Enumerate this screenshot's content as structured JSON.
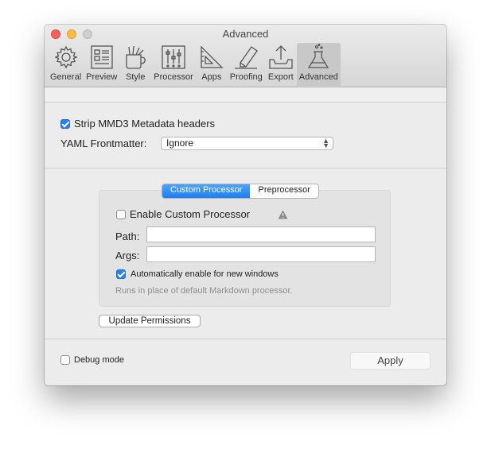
{
  "window": {
    "title": "Advanced"
  },
  "toolbar": {
    "items": [
      {
        "label": "General",
        "icon": "gear-icon"
      },
      {
        "label": "Preview",
        "icon": "preview-icon"
      },
      {
        "label": "Style",
        "icon": "style-icon"
      },
      {
        "label": "Processor",
        "icon": "processor-icon"
      },
      {
        "label": "Apps",
        "icon": "apps-icon"
      },
      {
        "label": "Proofing",
        "icon": "proofing-icon"
      },
      {
        "label": "Export",
        "icon": "export-icon"
      },
      {
        "label": "Advanced",
        "icon": "flask-icon"
      }
    ],
    "active": "Advanced"
  },
  "metadata": {
    "strip_label": "Strip MMD3 Metadata headers",
    "strip_checked": true,
    "yaml_label": "YAML Frontmatter:",
    "yaml_value": "Ignore"
  },
  "processor": {
    "tabs": [
      "Custom Processor",
      "Preprocessor"
    ],
    "active_tab": "Custom Processor",
    "enable_label": "Enable Custom Processor",
    "enable_checked": false,
    "path_label": "Path:",
    "path_value": "",
    "args_label": "Args:",
    "args_value": "",
    "auto_label": "Automatically enable for new windows",
    "auto_checked": true,
    "hint": "Runs in place of default Markdown processor."
  },
  "buttons": {
    "update_permissions": "Update Permissions",
    "apply": "Apply"
  },
  "footer": {
    "debug_label": "Debug mode",
    "debug_checked": false
  },
  "colors": {
    "accent": "#2a7ff0",
    "close": "#fc605c",
    "minimize": "#fdbc40"
  }
}
